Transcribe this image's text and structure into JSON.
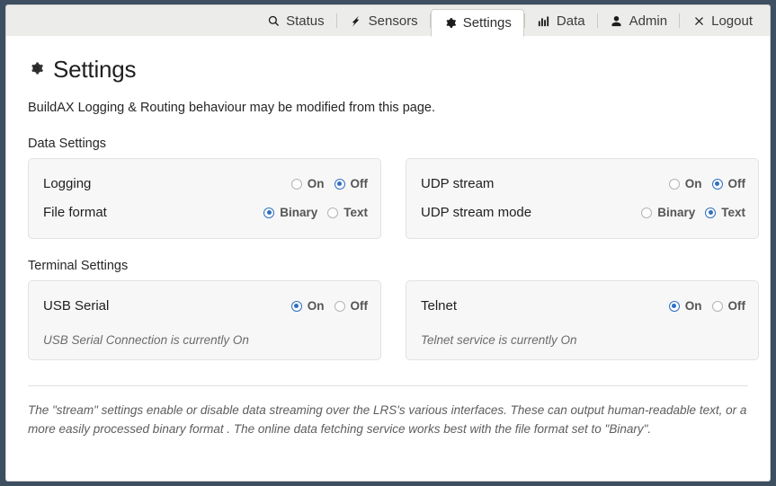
{
  "nav": {
    "tabs": [
      {
        "label": "Status",
        "icon": "search-icon",
        "active": false
      },
      {
        "label": "Sensors",
        "icon": "bolt-icon",
        "active": false
      },
      {
        "label": "Settings",
        "icon": "gear-icon",
        "active": true
      },
      {
        "label": "Data",
        "icon": "bar-chart-icon",
        "active": false
      },
      {
        "label": "Admin",
        "icon": "user-icon",
        "active": false
      },
      {
        "label": "Logout",
        "icon": "close-icon",
        "active": false
      }
    ]
  },
  "page": {
    "title": "Settings",
    "title_icon": "gear-icon",
    "intro": "BuildAX Logging & Routing behaviour may be modified from this page."
  },
  "sections": [
    {
      "label": "Data Settings",
      "cards": [
        {
          "rows": [
            {
              "label": "Logging",
              "choices": [
                {
                  "label": "On",
                  "selected": false
                },
                {
                  "label": "Off",
                  "selected": true
                }
              ]
            },
            {
              "label": "File format",
              "choices": [
                {
                  "label": "Binary",
                  "selected": true
                },
                {
                  "label": "Text",
                  "selected": false
                }
              ]
            }
          ],
          "note": ""
        },
        {
          "rows": [
            {
              "label": "UDP stream",
              "choices": [
                {
                  "label": "On",
                  "selected": false
                },
                {
                  "label": "Off",
                  "selected": true
                }
              ]
            },
            {
              "label": "UDP stream mode",
              "choices": [
                {
                  "label": "Binary",
                  "selected": false
                },
                {
                  "label": "Text",
                  "selected": true
                }
              ]
            }
          ],
          "note": ""
        }
      ]
    },
    {
      "label": "Terminal Settings",
      "cards": [
        {
          "rows": [
            {
              "label": "USB Serial",
              "choices": [
                {
                  "label": "On",
                  "selected": true
                },
                {
                  "label": "Off",
                  "selected": false
                }
              ]
            }
          ],
          "note": "USB Serial Connection is currently On"
        },
        {
          "rows": [
            {
              "label": "Telnet",
              "choices": [
                {
                  "label": "On",
                  "selected": true
                },
                {
                  "label": "Off",
                  "selected": false
                }
              ]
            }
          ],
          "note": "Telnet service is currently On"
        }
      ]
    }
  ],
  "footnote": "The \"stream\" settings enable or disable data streaming over the LRS's various interfaces. These can output human-readable text, or a more easily processed binary format . The online data fetching service works best with the file format set to \"Binary\".",
  "colors": {
    "page_background": "#3d4f61",
    "navbar_background": "#ececeb",
    "content_background": "#ffffff",
    "card_background": "#f7f7f7",
    "radio_selected": "#2f6fc0",
    "choice_label": "#555555",
    "note_text": "#6b6b6b"
  }
}
